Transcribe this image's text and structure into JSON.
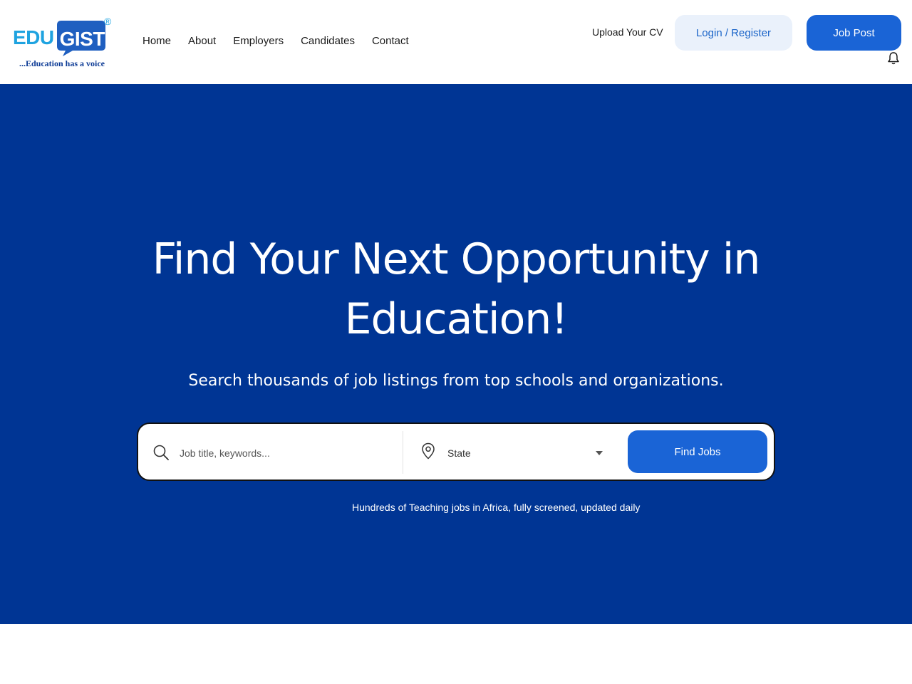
{
  "brand": {
    "edu": "EDU",
    "gist": "GIST",
    "registered": "®",
    "tagline": "...Education has a voice",
    "colors": {
      "edu": "#1fa3e0",
      "bubble": "#1f5fc0",
      "tagline": "#0e3c96"
    }
  },
  "nav": {
    "items": [
      {
        "label": "Home"
      },
      {
        "label": "About"
      },
      {
        "label": "Employers"
      },
      {
        "label": "Candidates"
      },
      {
        "label": "Contact"
      }
    ]
  },
  "header_actions": {
    "upload_cv": "Upload Your CV",
    "login_register": "Login / Register",
    "job_post": "Job Post",
    "bell_icon": "bell-icon"
  },
  "hero": {
    "title": "Find Your Next Opportunity in Education!",
    "subtitle": "Search thousands of job listings from top schools and organizations.",
    "note": "Hundreds of Teaching jobs in Africa, fully screened, updated daily",
    "background": "#003594"
  },
  "search": {
    "keyword_placeholder": "Job title, keywords...",
    "keyword_value": "",
    "state_selected": "State",
    "find_button": "Find Jobs",
    "icons": {
      "search": "search-icon",
      "location": "map-pin-icon",
      "dropdown": "caret-down-icon"
    }
  },
  "colors": {
    "accent": "#1a64d6",
    "accent_light": "#eaf1fb"
  }
}
